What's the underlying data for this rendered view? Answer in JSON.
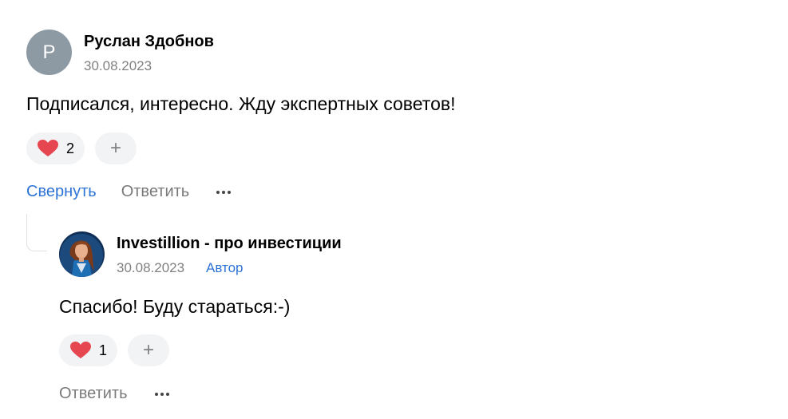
{
  "comment": {
    "avatar_letter": "Р",
    "author": "Руслан Здобнов",
    "date": "30.08.2023",
    "text": "Подписался, интересно. Жду экспертных советов!",
    "likes": "2",
    "add_reaction": "+",
    "actions": {
      "collapse": "Свернуть",
      "reply": "Ответить"
    }
  },
  "reply": {
    "avatar_icon": "investillion-avatar",
    "author": "Investillion - про инвестиции",
    "date": "30.08.2023",
    "badge": "Автор",
    "text": "Спасибо! Буду стараться:-)",
    "likes": "1",
    "add_reaction": "+",
    "actions": {
      "reply": "Ответить"
    }
  },
  "colors": {
    "link": "#2d74d6",
    "heart": "#e64650",
    "muted": "#808080",
    "pill": "#f2f3f5",
    "avatar_bg": "#8d9aa4"
  }
}
